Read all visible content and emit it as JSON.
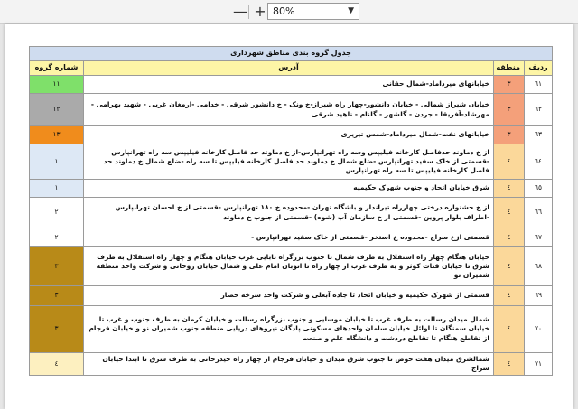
{
  "toolbar": {
    "zoom_out_label": "—",
    "zoom_in_label": "+",
    "zoom_value": "80%"
  },
  "table": {
    "title": "جدول گروه بندی مناطق شهرداری",
    "headers": {
      "row": "ردیف",
      "region": "منطقه",
      "address": "آدرس",
      "group": "شماره گروه"
    },
    "rows": [
      {
        "num": "٦١",
        "region": "٣",
        "address": "خیابانهای میرداماد-شمال حقانی",
        "group": "١١",
        "region_color": "#f4a07a",
        "group_color": "#7fe06a"
      },
      {
        "num": "٦٢",
        "region": "٣",
        "address": "خیابان شیراز شمالی - خیابان دانشور-چهار راه شیراز-خ ونک - خ دانشور شرقی - خدامی -ارمغان غربی - شهید بهرامی - مهرشاد-آفریقا - جردن - گلشهر - گلنام - ناهید شرقی",
        "group": "١٢",
        "region_color": "#f4a07a",
        "group_color": "#aaaaaa"
      },
      {
        "num": "٦٣",
        "region": "٣",
        "address": "خیابانهای نفت-شمال میرداماد-شمس تبریزی",
        "group": "١٣",
        "region_color": "#f4a07a",
        "group_color": "#f08c1c"
      },
      {
        "num": "٦٤",
        "region": "٤",
        "address": "از خ دماوند حدفاصل کارخانه فیلیپس وسه راه تهرانپارس-از خ دماوند حد فاصل کارخانه فیلیپس سه راه تهرانپارس -قسمتی از خاک سفید تهرانپارس -ضلع شمال خ دماوند حد فاصل کارخانه فیلیپس تا سه راه -ضلع شمال خ دماوند حد فاصل کارخانه فیلیپس تا سه راه تهرانپارس",
        "group": "١",
        "region_color": "#fbd89a",
        "group_color": "#dde8f5"
      },
      {
        "num": "٦٥",
        "region": "٤",
        "address": "شرق خیابان اتحاد و جنوب شهرک حکیمیه",
        "group": "١",
        "region_color": "#fbd89a",
        "group_color": "#dde8f5"
      },
      {
        "num": "٦٦",
        "region": "٤",
        "address": "از خ جشنواره درختی چهارراه تیرانداز و باشگاه تهران -محدوده خ ١٨٠ تهرانپارس -قسمتی از خ احسان تهرانپارس -اطراف بلوار پروین -قسمتی از خ سازمان آب (شوه) -قسمتی از جنوب خ دماوند",
        "group": "٢",
        "region_color": "#fbd89a",
        "group_color": "#ffffff"
      },
      {
        "num": "٦٧",
        "region": "٤",
        "address": "قسمتی ازخ سراج -محدوده خ استخر -قسمتی از خاک سفید تهرانپارس -",
        "group": "٢",
        "region_color": "#fbd89a",
        "group_color": "#ffffff"
      },
      {
        "num": "٦٨",
        "region": "٤",
        "address": "خیابان هنگام چهار راه استقلال به طرف شمال تا جنوب بزرگراه بابایی غرب خیابان هنگام و چهار راه استقلال به طرف شرق تا خیابان قنات کوثر و به طرف غرب از چهار راه تا اتوبان امام علی و شمال خیابان روحانی و شرکت واحد منطقه شمیران نو",
        "group": "٣",
        "region_color": "#fbd89a",
        "group_color": "#b88a18"
      },
      {
        "num": "٦٩",
        "region": "٤",
        "address": "قسمتی از شهرک حکیمیه و خیابان اتحاد تا جاده آبعلی و شرکت واحد سرخه حصار",
        "group": "٣",
        "region_color": "#fbd89a",
        "group_color": "#b88a18"
      },
      {
        "num": "٧٠",
        "region": "٤",
        "address": "شمال میدان رسالت به طرف غرب تا خیابان موسایی و جنوب بزرگراه رسالت و خیابان کرمان به طرف جنوب و غرب تا خیابان سمنگان تا اوائل خیابان سامان واحدهای مسکونی پادگان نیروهای دریایی منطقه جنوب شمیران نو و خیابان فرجام از تقاطع هنگام تا تقاطع دردشت و دانشگاه علم و صنعت",
        "group": "٣",
        "region_color": "#fbd89a",
        "group_color": "#b88a18"
      },
      {
        "num": "٧١",
        "region": "٤",
        "address": "شمالشرق میدان هفت حوض تا جنوب شرق میدان و خیابان فرجام از چهار راه حیدرخانی به طرف شرق تا ابتدا خیابان سراج",
        "group": "٤",
        "region_color": "#fbd89a",
        "group_color": "#fdf0c0"
      }
    ]
  }
}
